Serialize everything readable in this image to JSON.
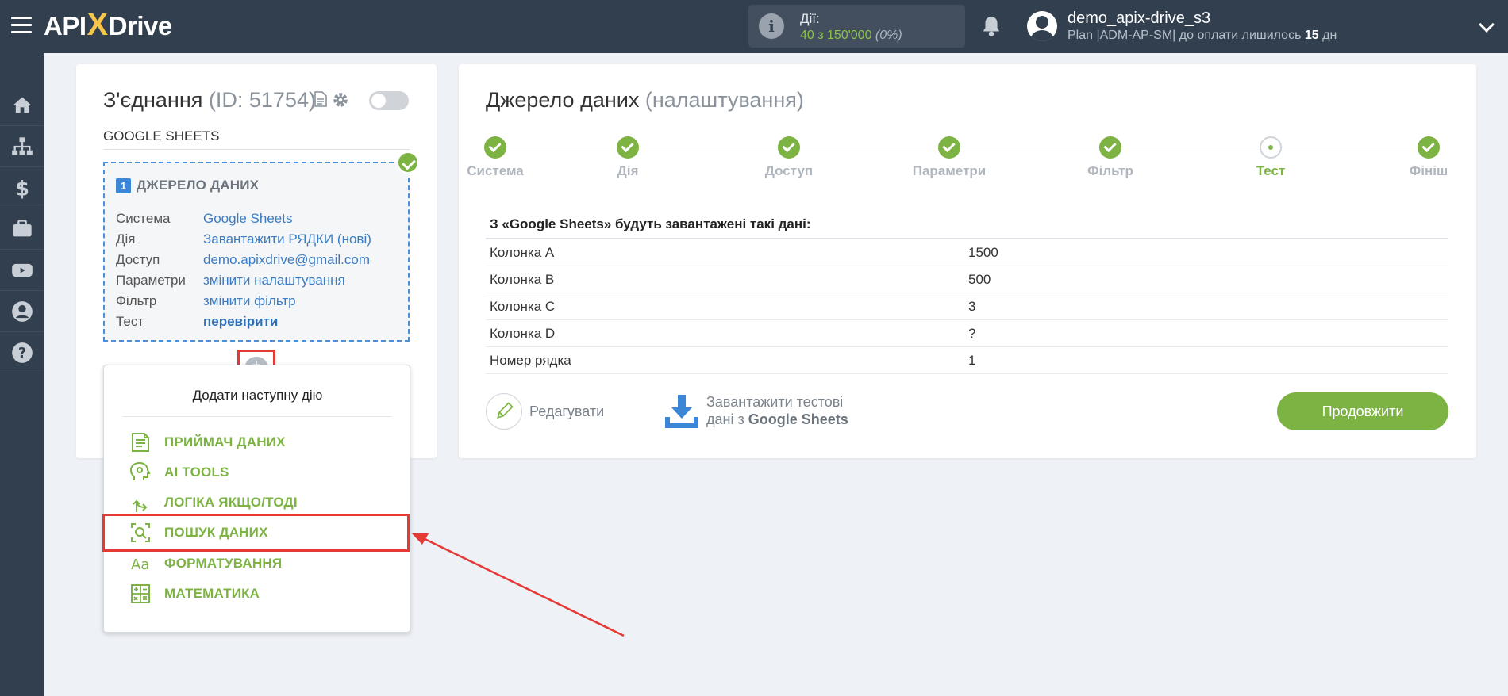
{
  "header": {
    "logo_left": "API",
    "logo_x": "X",
    "logo_right": "Drive",
    "actions_label": "Дії:",
    "actions_count": "40 з 150'000",
    "actions_percent": "(0%)",
    "user_name": "demo_apix-drive_s3",
    "plan_prefix": "Plan |ADM-AP-SM| до оплати лишилось",
    "plan_days": "15",
    "plan_suffix": "дн"
  },
  "sidebar": {
    "items": [
      "home-icon",
      "sitemap-icon",
      "dollar-icon",
      "briefcase-icon",
      "youtube-icon",
      "user-icon",
      "help-icon"
    ]
  },
  "connection": {
    "title": "З'єднання",
    "id_text": "(ID: 51754)",
    "service": "GOOGLE SHEETS",
    "source": {
      "number": "1",
      "title": "ДЖЕРЕЛО ДАНИХ",
      "rows": [
        {
          "key": "Система",
          "value": "Google Sheets"
        },
        {
          "key": "Дія",
          "value": "Завантажити РЯДКИ (нові)"
        },
        {
          "key": "Доступ",
          "value": "demo.apixdrive@gmail.com"
        },
        {
          "key": "Параметри",
          "value": "змінити налаштування"
        },
        {
          "key": "Фільтр",
          "value": "змінити фільтр"
        },
        {
          "key": "Тест",
          "value": "перевірити"
        }
      ]
    },
    "add_symbol": "+"
  },
  "dropdown": {
    "title": "Додати наступну дію",
    "items": [
      {
        "icon": "receiver-icon",
        "label": "ПРИЙМАЧ ДАНИХ"
      },
      {
        "icon": "ai-icon",
        "label": "AI TOOLS"
      },
      {
        "icon": "logic-icon",
        "label": "ЛОГІКА ЯКЩО/ТОДІ"
      },
      {
        "icon": "search-data-icon",
        "label": "ПОШУК ДАНИХ"
      },
      {
        "icon": "format-icon",
        "label": "ФОРМАТУВАННЯ"
      },
      {
        "icon": "math-icon",
        "label": "МАТЕМАТИКА"
      }
    ]
  },
  "source_settings": {
    "title": "Джерело даних",
    "subtitle": "(налаштування)",
    "steps": [
      {
        "label": "Система",
        "state": "done"
      },
      {
        "label": "Дія",
        "state": "done"
      },
      {
        "label": "Доступ",
        "state": "done"
      },
      {
        "label": "Параметри",
        "state": "done"
      },
      {
        "label": "Фільтр",
        "state": "done"
      },
      {
        "label": "Тест",
        "state": "current"
      },
      {
        "label": "Фініш",
        "state": "done"
      }
    ],
    "data_heading": "З «Google Sheets» будуть завантажені такі дані:",
    "rows": [
      {
        "key": "Колонка A",
        "value": "1500"
      },
      {
        "key": "Колонка B",
        "value": "500"
      },
      {
        "key": "Колонка C",
        "value": "3"
      },
      {
        "key": "Колонка D",
        "value": "?"
      },
      {
        "key": "Номер рядка",
        "value": "1"
      }
    ],
    "edit_label": "Редагувати",
    "download_line1": "Завантажити тестові",
    "download_line2_prefix": "дані з",
    "download_line2_bold": "Google Sheets",
    "continue_label": "Продовжити"
  },
  "colors": {
    "topbar": "#323f4f",
    "accent_green": "#7cb342",
    "link_blue": "#3b7cc4",
    "highlight_red": "#e53935"
  }
}
